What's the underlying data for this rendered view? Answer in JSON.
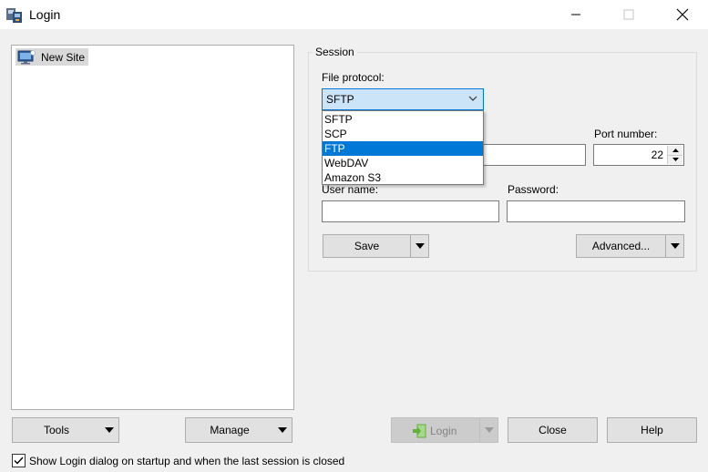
{
  "window": {
    "title": "Login"
  },
  "site_tree": {
    "items": [
      {
        "label": "New Site",
        "icon": "monitor-icon",
        "selected": true
      }
    ]
  },
  "session": {
    "group_label": "Session",
    "file_protocol_label": "File protocol:",
    "file_protocol_value": "SFTP",
    "protocol_options": [
      "SFTP",
      "SCP",
      "FTP",
      "WebDAV",
      "Amazon S3"
    ],
    "highlighted_option": "FTP",
    "port_label": "Port number:",
    "port_value": "22",
    "host_value": "",
    "username_label": "User name:",
    "username_value": "",
    "password_label": "Password:",
    "password_value": "",
    "save_label": "Save",
    "advanced_label": "Advanced..."
  },
  "bottom": {
    "tools_label": "Tools",
    "manage_label": "Manage",
    "login_label": "Login",
    "close_label": "Close",
    "help_label": "Help",
    "show_login_label": "Show Login dialog on startup and when the last session is closed",
    "show_login_checked": true
  },
  "colors": {
    "accent": "#0078d7",
    "select_bg": "#cce4f7",
    "button_bg": "#e1e1e1",
    "disabled_bg": "#cccccc",
    "login_icon_green": "#5fb336"
  }
}
